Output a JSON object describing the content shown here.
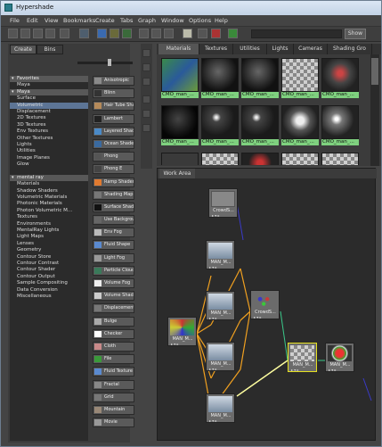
{
  "window": {
    "title": "Hypershade"
  },
  "menu": [
    "File",
    "Edit",
    "View",
    "Bookmarks",
    "Create",
    "Tabs",
    "Graph",
    "Window",
    "Options",
    "Help"
  ],
  "toolbar": {
    "show_label": "Show"
  },
  "left_tabs": [
    "Create",
    "Bins"
  ],
  "create_tree": [
    {
      "label": "Favorites",
      "kind": "hdr"
    },
    {
      "label": "Maya",
      "kind": "item"
    },
    {
      "label": "Maya",
      "kind": "hdr"
    },
    {
      "label": "Surface",
      "kind": "item"
    },
    {
      "label": "Volumetric",
      "kind": "item"
    },
    {
      "label": "Displacement",
      "kind": "item"
    },
    {
      "label": "2D Textures",
      "kind": "item"
    },
    {
      "label": "3D Textures",
      "kind": "item"
    },
    {
      "label": "Env Textures",
      "kind": "item"
    },
    {
      "label": "Other Textures",
      "kind": "item"
    },
    {
      "label": "Lights",
      "kind": "item"
    },
    {
      "label": "Utilities",
      "kind": "item"
    },
    {
      "label": "Image Planes",
      "kind": "item"
    },
    {
      "label": "Glow",
      "kind": "item"
    },
    {
      "label": "",
      "kind": "gap"
    },
    {
      "label": "mental ray",
      "kind": "hdr"
    },
    {
      "label": "Materials",
      "kind": "item"
    },
    {
      "label": "Shadow Shaders",
      "kind": "item"
    },
    {
      "label": "Volumetric Materials",
      "kind": "item"
    },
    {
      "label": "Photonic Materials",
      "kind": "item"
    },
    {
      "label": "Photon Volumetric M...",
      "kind": "item"
    },
    {
      "label": "Textures",
      "kind": "item"
    },
    {
      "label": "Environments",
      "kind": "item"
    },
    {
      "label": "MentalRay Lights",
      "kind": "item"
    },
    {
      "label": "Light Maps",
      "kind": "item"
    },
    {
      "label": "Lenses",
      "kind": "item"
    },
    {
      "label": "Geometry",
      "kind": "item"
    },
    {
      "label": "Contour Store",
      "kind": "item"
    },
    {
      "label": "Contour Contrast",
      "kind": "item"
    },
    {
      "label": "Contour Shader",
      "kind": "item"
    },
    {
      "label": "Contour Output",
      "kind": "item"
    },
    {
      "label": "Sample Compositing",
      "kind": "item"
    },
    {
      "label": "Data Conversion",
      "kind": "item"
    },
    {
      "label": "Miscellaneous",
      "kind": "item"
    }
  ],
  "node_buttons": [
    {
      "label": "Anisotropic",
      "color": "#8a8a8a"
    },
    {
      "label": "Blinn",
      "color": "#333"
    },
    {
      "label": "Hair Tube Shader",
      "color": "#b58a5a"
    },
    {
      "label": "Lambert",
      "color": "#222"
    },
    {
      "label": "Layered Shader",
      "color": "#4a8ac8"
    },
    {
      "label": "Ocean Shader",
      "color": "#3a6aa0"
    },
    {
      "label": "Phong",
      "color": "#555"
    },
    {
      "label": "Phong E",
      "color": "#444"
    },
    {
      "label": "Ramp Shader",
      "color": "#e07a30"
    },
    {
      "label": "Shading Map",
      "color": "#777"
    },
    {
      "label": "Surface Shader",
      "color": "#111"
    },
    {
      "label": "Use Background",
      "color": "#666"
    },
    {
      "label": "Env Fog",
      "color": "#bbb"
    },
    {
      "label": "Fluid Shape",
      "color": "#5a8ad0"
    },
    {
      "label": "Light Fog",
      "color": "#999"
    },
    {
      "label": "Particle Cloud",
      "color": "#3a7a5a"
    },
    {
      "label": "Volume Fog",
      "color": "#eee"
    },
    {
      "label": "Volume Shader",
      "color": "#ccc"
    },
    {
      "label": "Displacement",
      "color": "#777"
    },
    {
      "label": "Bulge",
      "color": "#aaa"
    },
    {
      "label": "Checker",
      "color": "#fff"
    },
    {
      "label": "Cloth",
      "color": "#c98a8a"
    },
    {
      "label": "File",
      "color": "#3a9a3a"
    },
    {
      "label": "Fluid Texture 2D",
      "color": "#5a8ad0"
    },
    {
      "label": "Fractal",
      "color": "#888"
    },
    {
      "label": "Grid",
      "color": "#777"
    },
    {
      "label": "Mountain",
      "color": "#998877"
    },
    {
      "label": "Movie",
      "color": "#999"
    }
  ],
  "material_tabs": [
    "Materials",
    "Textures",
    "Utilities",
    "Lights",
    "Cameras",
    "Shading Gro"
  ],
  "swatches": [
    {
      "label": "CMO_man_...",
      "style": "tex"
    },
    {
      "label": "CMO_man_...",
      "style": "dark"
    },
    {
      "label": "CMO_man_...",
      "style": "dark"
    },
    {
      "label": "CMO_man_...",
      "style": "check"
    },
    {
      "label": "CMO_man_...",
      "style": "redfig"
    },
    {
      "label": "CMO_man_...",
      "style": "black"
    },
    {
      "label": "CMO_man_...",
      "style": "darkspec"
    },
    {
      "label": "CMO_man_...",
      "style": "darkspec"
    },
    {
      "label": "CMO_man_...",
      "style": "whitefig"
    },
    {
      "label": "CMO_man_...",
      "style": "spot"
    }
  ],
  "work_area": {
    "tab_label": "Work Area"
  },
  "graph_nodes": [
    {
      "id": "n0",
      "label": "CrowdS...",
      "thumb": "gray"
    },
    {
      "id": "n1",
      "label": "MAN_M...",
      "thumb": "robot"
    },
    {
      "id": "n2",
      "label": "MAN_M...",
      "thumb": "robot"
    },
    {
      "id": "n3",
      "label": "CrowdS...",
      "thumb": "balls"
    },
    {
      "id": "n4",
      "label": "MAN_M...",
      "thumb": "tex"
    },
    {
      "id": "n5",
      "label": "MAN_M...",
      "thumb": "robot"
    },
    {
      "id": "n6",
      "label": "MAN_M...",
      "thumb": "robot"
    },
    {
      "id": "n7",
      "label": "MAN_M...",
      "thumb": "check"
    },
    {
      "id": "n8",
      "label": "MAN_M...",
      "thumb": "ball"
    }
  ]
}
